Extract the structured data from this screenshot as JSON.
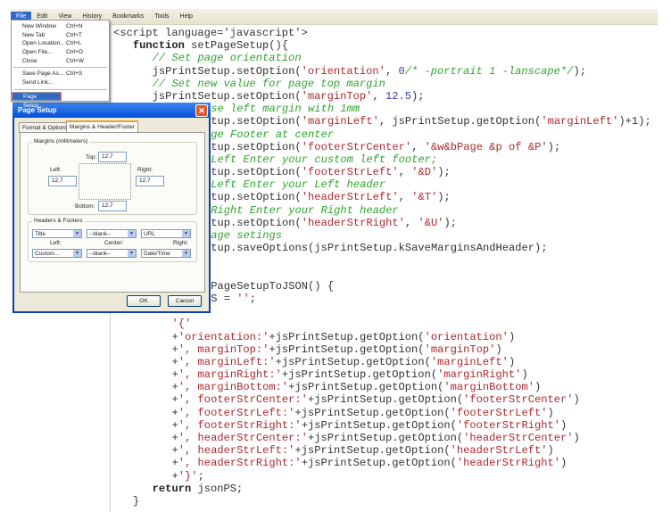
{
  "menubar": {
    "items": [
      "File",
      "Edit",
      "View",
      "History",
      "Bookmarks",
      "Tools",
      "Help"
    ]
  },
  "file_menu": {
    "items": [
      {
        "label": "New Window",
        "shortcut": "Ctrl+N"
      },
      {
        "label": "New Tab",
        "shortcut": "Ctrl+T"
      },
      {
        "label": "Open Location...",
        "shortcut": "Ctrl+L"
      },
      {
        "label": "Open File...",
        "shortcut": "Ctrl+O"
      },
      {
        "label": "Close",
        "shortcut": "Ctrl+W"
      },
      {
        "label": "Save Page As...",
        "shortcut": "Ctrl+S"
      },
      {
        "label": "Send Link...",
        "shortcut": ""
      },
      {
        "label": "Page Setup...",
        "shortcut": ""
      }
    ]
  },
  "dialog": {
    "title": "Page Setup",
    "tabs": [
      "Format & Options",
      "Margins & Header/Footer"
    ],
    "margins_label": "Margins (millimeters)",
    "top_label": "Top:",
    "top": "12.7",
    "left_label": "Left:",
    "left": "12.7",
    "right_label": "Right:",
    "right": "12.7",
    "bottom_label": "Bottom:",
    "bottom": "12.7",
    "hf_label": "Headers & Footers",
    "header": [
      "Title",
      "--blank--",
      "URL"
    ],
    "col_labels": [
      "Left:",
      "Center:",
      "Right:"
    ],
    "footer": [
      "Custom...",
      "--blank--",
      "Date/Time"
    ],
    "ok": "OK",
    "cancel": "Cancel"
  },
  "code": [
    {
      "col": 0,
      "seg": [
        [
          "p",
          "<script language='javascript'>"
        ]
      ]
    },
    {
      "col": 3,
      "seg": [
        [
          "k",
          "function"
        ],
        [
          "p",
          " setPageSetup(){"
        ]
      ]
    },
    {
      "col": 6,
      "seg": [
        [
          "c",
          "// Set page orientation"
        ]
      ]
    },
    {
      "col": 6,
      "seg": [
        [
          "p",
          "jsPrintSetup.setOption("
        ],
        [
          "s",
          "'orientation'"
        ],
        [
          "p",
          ", "
        ],
        [
          "n",
          "0"
        ],
        [
          "c",
          "/* -portrait 1 -lanscape*/"
        ],
        [
          "p",
          ");"
        ]
      ]
    },
    {
      "col": 6,
      "seg": [
        [
          "c",
          "// Set new value for page top margin"
        ]
      ]
    },
    {
      "col": 6,
      "seg": [
        [
          "p",
          "jsPrintSetup.setOption("
        ],
        [
          "s",
          "'marginTop'"
        ],
        [
          "p",
          ", "
        ],
        [
          "n",
          "12.5"
        ],
        [
          "p",
          ");"
        ]
      ]
    },
    {
      "col": 15,
      "seg": [
        [
          "c",
          "se left margin with 1mm"
        ]
      ]
    },
    {
      "col": 15,
      "seg": [
        [
          "p",
          "tup.setOption("
        ],
        [
          "s",
          "'marginLeft'"
        ],
        [
          "p",
          ", jsPrintSetup.getOption("
        ],
        [
          "s",
          "'marginLeft'"
        ],
        [
          "p",
          ")+1);"
        ]
      ]
    },
    {
      "col": 15,
      "seg": [
        [
          "c",
          "ge Footer at center"
        ]
      ]
    },
    {
      "col": 15,
      "seg": [
        [
          "p",
          "tup.setOption("
        ],
        [
          "s",
          "'footerStrCenter'"
        ],
        [
          "p",
          ", "
        ],
        [
          "s",
          "'&w&bPage &p of &P'"
        ],
        [
          "p",
          ");"
        ]
      ]
    },
    {
      "col": 15,
      "seg": [
        [
          "c",
          "Left Enter your custom left footer;"
        ]
      ]
    },
    {
      "col": 15,
      "seg": [
        [
          "p",
          "tup.setOption("
        ],
        [
          "s",
          "'footerStrLeft'"
        ],
        [
          "p",
          ", "
        ],
        [
          "s",
          "'&D'"
        ],
        [
          "p",
          ");"
        ]
      ]
    },
    {
      "col": 15,
      "seg": [
        [
          "c",
          "Left Enter your Left header"
        ]
      ]
    },
    {
      "col": 15,
      "seg": [
        [
          "p",
          "tup.setOption("
        ],
        [
          "s",
          "'headerStrLeft'"
        ],
        [
          "p",
          ", "
        ],
        [
          "s",
          "'&T'"
        ],
        [
          "p",
          ");"
        ]
      ]
    },
    {
      "col": 15,
      "seg": [
        [
          "c",
          "Right Enter your Right header"
        ]
      ]
    },
    {
      "col": 15,
      "seg": [
        [
          "p",
          "tup.setOption("
        ],
        [
          "s",
          "'headerStrRight'"
        ],
        [
          "p",
          ", "
        ],
        [
          "s",
          "'&U'"
        ],
        [
          "p",
          ");"
        ]
      ]
    },
    {
      "col": 15,
      "seg": [
        [
          "c",
          "age setings"
        ]
      ]
    },
    {
      "col": 15,
      "seg": [
        [
          "p",
          "tup.saveOptions(jsPrintSetup.kSaveMarginsAndHeader);"
        ]
      ]
    },
    {
      "col": 0,
      "seg": []
    },
    {
      "col": 0,
      "seg": []
    },
    {
      "col": 15,
      "seg": [
        [
          "p",
          "PageSetupToJSON() {"
        ]
      ]
    },
    {
      "col": 15,
      "seg": [
        [
          "p",
          "S = "
        ],
        [
          "s",
          "''"
        ],
        [
          "p",
          ";"
        ]
      ]
    },
    {
      "col": 0,
      "seg": []
    },
    {
      "col": 9,
      "seg": [
        [
          "s",
          "'{'"
        ]
      ]
    },
    {
      "col": 9,
      "seg": [
        [
          "p",
          "+"
        ],
        [
          "s",
          "'orientation:'"
        ],
        [
          "p",
          "+jsPrintSetup.getOption("
        ],
        [
          "s",
          "'orientation'"
        ],
        [
          "p",
          ")"
        ]
      ]
    },
    {
      "col": 9,
      "seg": [
        [
          "p",
          "+"
        ],
        [
          "s",
          "', marginTop:'"
        ],
        [
          "p",
          "+jsPrintSetup.getOption("
        ],
        [
          "s",
          "'marginTop'"
        ],
        [
          "p",
          ")"
        ]
      ]
    },
    {
      "col": 9,
      "seg": [
        [
          "p",
          "+"
        ],
        [
          "s",
          "', marginLeft:'"
        ],
        [
          "p",
          "+jsPrintSetup.getOption("
        ],
        [
          "s",
          "'marginLeft'"
        ],
        [
          "p",
          ")"
        ]
      ]
    },
    {
      "col": 9,
      "seg": [
        [
          "p",
          "+"
        ],
        [
          "s",
          "', marginRight:'"
        ],
        [
          "p",
          "+jsPrintSetup.getOption("
        ],
        [
          "s",
          "'marginRight'"
        ],
        [
          "p",
          ")"
        ]
      ]
    },
    {
      "col": 9,
      "seg": [
        [
          "p",
          "+"
        ],
        [
          "s",
          "', marginBottom:'"
        ],
        [
          "p",
          "+jsPrintSetup.getOption("
        ],
        [
          "s",
          "'marginBottom'"
        ],
        [
          "p",
          ")"
        ]
      ]
    },
    {
      "col": 9,
      "seg": [
        [
          "p",
          "+"
        ],
        [
          "s",
          "', footerStrCenter:'"
        ],
        [
          "p",
          "+jsPrintSetup.getOption("
        ],
        [
          "s",
          "'footerStrCenter'"
        ],
        [
          "p",
          ")"
        ]
      ]
    },
    {
      "col": 9,
      "seg": [
        [
          "p",
          "+"
        ],
        [
          "s",
          "', footerStrLeft:'"
        ],
        [
          "p",
          "+jsPrintSetup.getOption("
        ],
        [
          "s",
          "'footerStrLeft'"
        ],
        [
          "p",
          ")"
        ]
      ]
    },
    {
      "col": 9,
      "seg": [
        [
          "p",
          "+"
        ],
        [
          "s",
          "', footerStrRight:'"
        ],
        [
          "p",
          "+jsPrintSetup.getOption("
        ],
        [
          "s",
          "'footerStrRight'"
        ],
        [
          "p",
          ")"
        ]
      ]
    },
    {
      "col": 9,
      "seg": [
        [
          "p",
          "+"
        ],
        [
          "s",
          "', headerStrCenter:'"
        ],
        [
          "p",
          "+jsPrintSetup.getOption("
        ],
        [
          "s",
          "'headerStrCenter'"
        ],
        [
          "p",
          ")"
        ]
      ]
    },
    {
      "col": 9,
      "seg": [
        [
          "p",
          "+"
        ],
        [
          "s",
          "', headerStrLeft:'"
        ],
        [
          "p",
          "+jsPrintSetup.getOption("
        ],
        [
          "s",
          "'headerStrLeft'"
        ],
        [
          "p",
          ")"
        ]
      ]
    },
    {
      "col": 9,
      "seg": [
        [
          "p",
          "+"
        ],
        [
          "s",
          "', headerStrRight:'"
        ],
        [
          "p",
          "+jsPrintSetup.getOption("
        ],
        [
          "s",
          "'headerStrRight'"
        ],
        [
          "p",
          ")"
        ]
      ]
    },
    {
      "col": 9,
      "seg": [
        [
          "p",
          "+"
        ],
        [
          "s",
          "'}'"
        ],
        [
          "p",
          ";"
        ]
      ]
    },
    {
      "col": 6,
      "seg": [
        [
          "k",
          "return"
        ],
        [
          "p",
          " jsonPS;"
        ]
      ]
    },
    {
      "col": 3,
      "seg": [
        [
          "p",
          "}"
        ]
      ]
    }
  ]
}
